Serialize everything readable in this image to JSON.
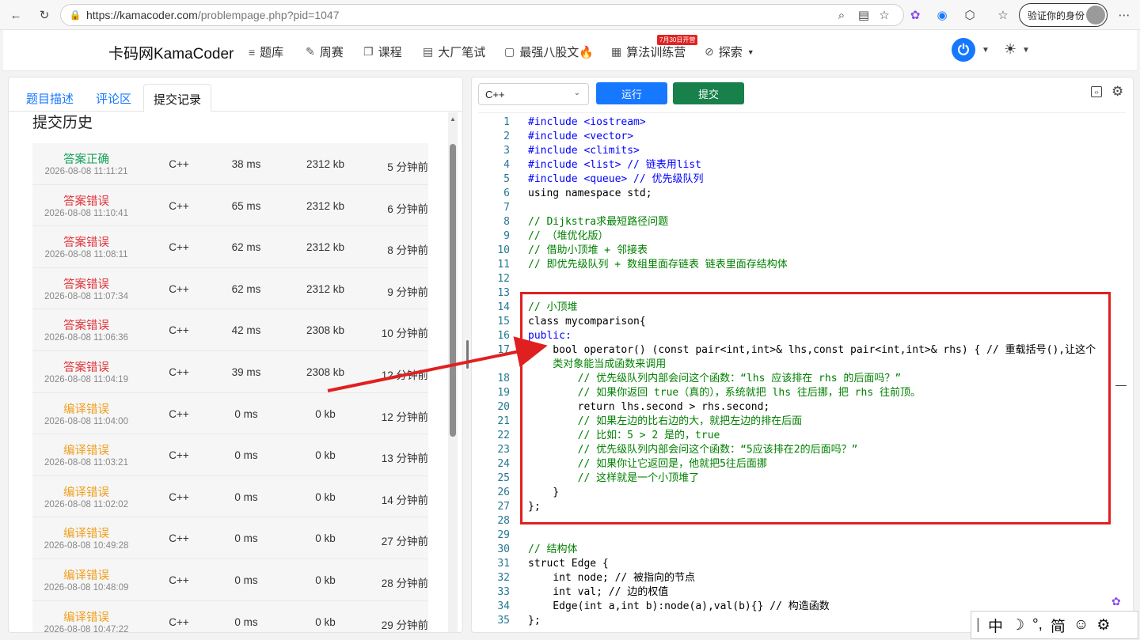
{
  "browser": {
    "url_main": "https://kamacoder.com",
    "url_path": "/problempage.php?pid=1047",
    "profile_label": "验证你的身份",
    "icons": [
      "back-icon",
      "reload-icon",
      "lock-icon",
      "zoom-icon",
      "reader-icon",
      "favorite-icon",
      "extension-icon",
      "collections-icon",
      "profile-avatar-icon",
      "more-icon"
    ]
  },
  "header": {
    "logo": "卡码网KamaCoder",
    "nav": [
      {
        "label": "题库",
        "icon": "list-icon"
      },
      {
        "label": "周赛",
        "icon": "pen-icon"
      },
      {
        "label": "课程",
        "icon": "copy-icon"
      },
      {
        "label": "大厂笔试",
        "icon": "doc-icon"
      },
      {
        "label": "最强八股文🔥",
        "icon": "video-icon"
      },
      {
        "label": "算法训练营",
        "icon": "calendar-icon"
      },
      {
        "label": "探索",
        "icon": "compass-icon"
      }
    ],
    "promo_badge": "7月30日开营"
  },
  "left": {
    "tabs": [
      "题目描述",
      "评论区",
      "提交记录"
    ],
    "active_tab": 2,
    "history_title": "提交历史",
    "submissions": [
      {
        "status": "答案正确",
        "kind": "ok",
        "date": "2026-08-08 11:11:21",
        "lang": "C++",
        "time": "38 ms",
        "mem": "2312 kb",
        "ago": "5 分钟前"
      },
      {
        "status": "答案错误",
        "kind": "wa",
        "date": "2026-08-08 11:10:41",
        "lang": "C++",
        "time": "65 ms",
        "mem": "2312 kb",
        "ago": "6 分钟前"
      },
      {
        "status": "答案错误",
        "kind": "wa",
        "date": "2026-08-08 11:08:11",
        "lang": "C++",
        "time": "62 ms",
        "mem": "2312 kb",
        "ago": "8 分钟前"
      },
      {
        "status": "答案错误",
        "kind": "wa",
        "date": "2026-08-08 11:07:34",
        "lang": "C++",
        "time": "62 ms",
        "mem": "2312 kb",
        "ago": "9 分钟前"
      },
      {
        "status": "答案错误",
        "kind": "wa",
        "date": "2026-08-08 11:06:36",
        "lang": "C++",
        "time": "42 ms",
        "mem": "2308 kb",
        "ago": "10 分钟前"
      },
      {
        "status": "答案错误",
        "kind": "wa",
        "date": "2026-08-08 11:04:19",
        "lang": "C++",
        "time": "39 ms",
        "mem": "2308 kb",
        "ago": "12 分钟前"
      },
      {
        "status": "编译错误",
        "kind": "ce",
        "date": "2026-08-08 11:04:00",
        "lang": "C++",
        "time": "0 ms",
        "mem": "0 kb",
        "ago": "12 分钟前"
      },
      {
        "status": "编译错误",
        "kind": "ce",
        "date": "2026-08-08 11:03:21",
        "lang": "C++",
        "time": "0 ms",
        "mem": "0 kb",
        "ago": "13 分钟前"
      },
      {
        "status": "编译错误",
        "kind": "ce",
        "date": "2026-08-08 11:02:02",
        "lang": "C++",
        "time": "0 ms",
        "mem": "0 kb",
        "ago": "14 分钟前"
      },
      {
        "status": "编译错误",
        "kind": "ce",
        "date": "2026-08-08 10:49:28",
        "lang": "C++",
        "time": "0 ms",
        "mem": "0 kb",
        "ago": "27 分钟前"
      },
      {
        "status": "编译错误",
        "kind": "ce",
        "date": "2026-08-08 10:48:09",
        "lang": "C++",
        "time": "0 ms",
        "mem": "0 kb",
        "ago": "28 分钟前"
      },
      {
        "status": "编译错误",
        "kind": "ce",
        "date": "2026-08-08 10:47:22",
        "lang": "C++",
        "time": "0 ms",
        "mem": "0 kb",
        "ago": "29 分钟前"
      }
    ]
  },
  "editor": {
    "language": "C++",
    "run_label": "运行",
    "submit_label": "提交",
    "lines": [
      {
        "n": "1",
        "t": "#include <iostream>",
        "c": "kw"
      },
      {
        "n": "2",
        "t": "#include <vector>",
        "c": "kw"
      },
      {
        "n": "3",
        "t": "#include <climits>",
        "c": "kw"
      },
      {
        "n": "4",
        "t": "#include <list> // 链表用list",
        "c": "kw"
      },
      {
        "n": "5",
        "t": "#include <queue> // 优先级队列",
        "c": "kw"
      },
      {
        "n": "6",
        "t": "using namespace std;",
        "c": "pl"
      },
      {
        "n": "7",
        "t": "",
        "c": "pl"
      },
      {
        "n": "8",
        "t": "// Dijkstra求最短路径问题",
        "c": "cm"
      },
      {
        "n": "9",
        "t": "// （堆优化版）",
        "c": "cm"
      },
      {
        "n": "10",
        "t": "// 借助小顶堆 + 邻接表",
        "c": "cm"
      },
      {
        "n": "11",
        "t": "// 即优先级队列 + 数组里面存链表 链表里面存结构体",
        "c": "cm"
      },
      {
        "n": "12",
        "t": "",
        "c": "pl"
      },
      {
        "n": "13",
        "t": "",
        "c": "pl"
      },
      {
        "n": "14",
        "t": "// 小顶堆",
        "c": "cm"
      },
      {
        "n": "15",
        "t": "class mycomparison{",
        "c": "pl"
      },
      {
        "n": "16",
        "t": "public:",
        "c": "kw"
      },
      {
        "n": "17",
        "t": "    bool operator() (const pair<int,int>& lhs,const pair<int,int>& rhs) { // 重载括号(),让这个",
        "c": "pl"
      },
      {
        "n": "",
        "t": "    类对象能当成函数来调用",
        "c": "cm"
      },
      {
        "n": "18",
        "t": "        // 优先级队列内部会问这个函数：“lhs 应该排在 rhs 的后面吗？”",
        "c": "cm"
      },
      {
        "n": "19",
        "t": "        // 如果你返回 true（真的），系统就把 lhs 往后挪，把 rhs 往前顶。",
        "c": "cm"
      },
      {
        "n": "20",
        "t": "        return lhs.second > rhs.second;",
        "c": "pl"
      },
      {
        "n": "21",
        "t": "        // 如果左边的比右边的大，就把左边的排在后面",
        "c": "cm"
      },
      {
        "n": "22",
        "t": "        // 比如：5 > 2 是的，true",
        "c": "cm"
      },
      {
        "n": "23",
        "t": "        // 优先级队列内部会问这个函数：“5应该排在2的后面吗？”",
        "c": "cm"
      },
      {
        "n": "24",
        "t": "        // 如果你让它返回是，他就把5往后面挪",
        "c": "cm"
      },
      {
        "n": "25",
        "t": "        // 这样就是一个小顶堆了",
        "c": "cm"
      },
      {
        "n": "26",
        "t": "    }",
        "c": "pl"
      },
      {
        "n": "27",
        "t": "};",
        "c": "pl"
      },
      {
        "n": "28",
        "t": "",
        "c": "pl"
      },
      {
        "n": "29",
        "t": "",
        "c": "pl"
      },
      {
        "n": "30",
        "t": "// 结构体",
        "c": "cm"
      },
      {
        "n": "31",
        "t": "struct Edge {",
        "c": "pl"
      },
      {
        "n": "32",
        "t": "    int node; // 被指向的节点",
        "c": "pl"
      },
      {
        "n": "33",
        "t": "    int val; // 边的权值",
        "c": "pl"
      },
      {
        "n": "34",
        "t": "    Edge(int a,int b):node(a),val(b){} // 构造函数",
        "c": "pl"
      },
      {
        "n": "35",
        "t": "};",
        "c": "pl"
      }
    ]
  },
  "ime": {
    "items": [
      "中",
      "☽",
      "°,",
      "简",
      "☺",
      "⚙"
    ]
  },
  "colors": {
    "accent": "#1677ff",
    "submit": "#18804a",
    "ok": "#18a058",
    "wrong": "#e0383e",
    "compile": "#f0a020",
    "annotation": "#e02020"
  }
}
